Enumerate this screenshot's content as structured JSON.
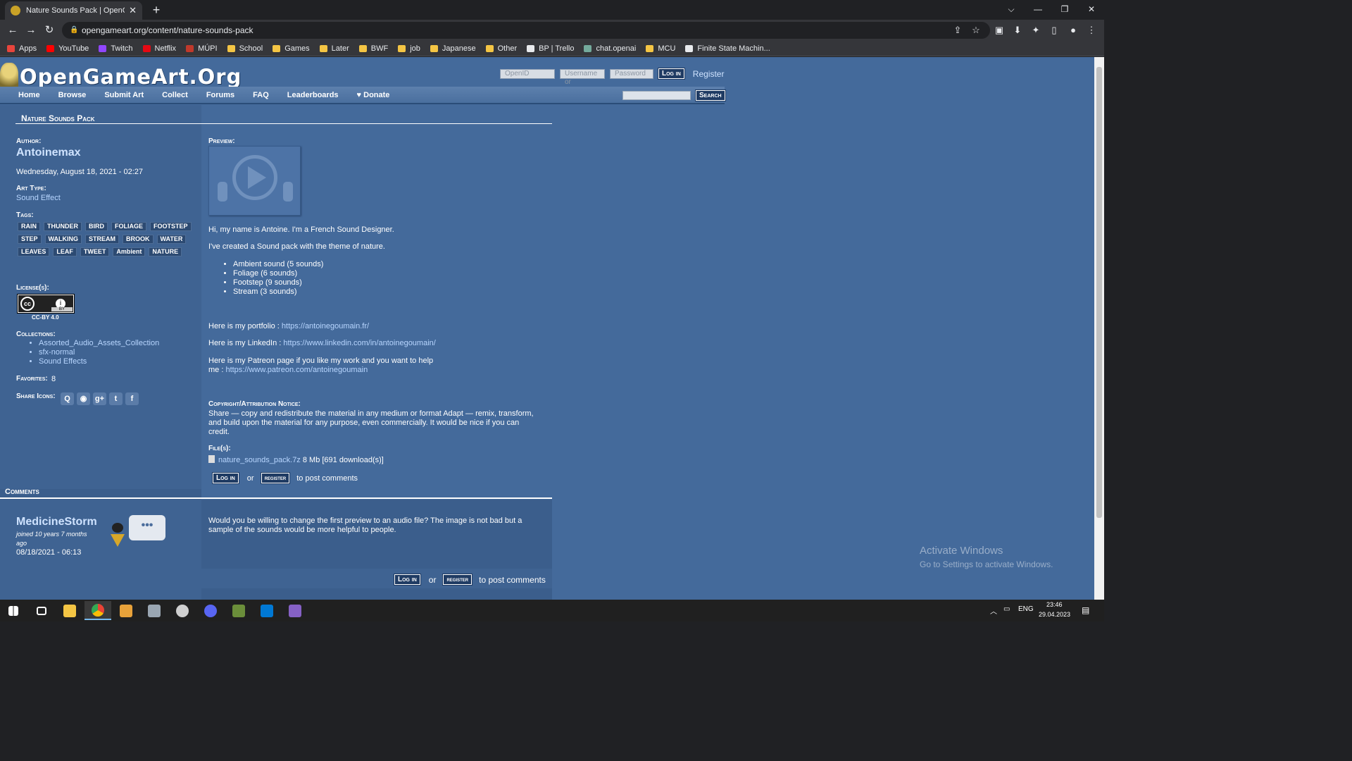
{
  "browser": {
    "tab_title": "Nature Sounds Pack | OpenGame",
    "tab_close": "✕",
    "new_tab": "+",
    "url": "opengameart.org/content/nature-sounds-pack",
    "bookmarks": [
      {
        "label": "Apps",
        "icon": "apps-grid-icon",
        "color": "#e8453c"
      },
      {
        "label": "YouTube",
        "icon": "youtube-icon",
        "color": "#ff0000"
      },
      {
        "label": "Twitch",
        "icon": "twitch-icon",
        "color": "#9146ff"
      },
      {
        "label": "Netflix",
        "icon": "netflix-icon",
        "color": "#e50914"
      },
      {
        "label": "MÚPI",
        "icon": "mupi-icon",
        "color": "#c0392b"
      },
      {
        "label": "School",
        "icon": "folder-icon",
        "color": "#f4c544"
      },
      {
        "label": "Games",
        "icon": "folder-icon",
        "color": "#f4c544"
      },
      {
        "label": "Later",
        "icon": "folder-icon",
        "color": "#f4c544"
      },
      {
        "label": "BWF",
        "icon": "folder-icon",
        "color": "#f4c544"
      },
      {
        "label": "job",
        "icon": "folder-icon",
        "color": "#f4c544"
      },
      {
        "label": "Japanese",
        "icon": "folder-icon",
        "color": "#f4c544"
      },
      {
        "label": "Other",
        "icon": "folder-icon",
        "color": "#f4c544"
      },
      {
        "label": "BP | Trello",
        "icon": "trello-icon",
        "color": "#e8eaed"
      },
      {
        "label": "chat.openai",
        "icon": "openai-icon",
        "color": "#74aa9c"
      },
      {
        "label": "MCU",
        "icon": "folder-icon",
        "color": "#f4c544"
      },
      {
        "label": "Finite State Machin...",
        "icon": "e-icon",
        "color": "#e8eaed"
      }
    ]
  },
  "site": {
    "logo": "OpenGameArt.Org",
    "login": {
      "openid": "OpenID",
      "username": "Username or",
      "password": "Password",
      "button": "Log in",
      "register": "Register"
    },
    "nav": [
      "Home",
      "Browse",
      "Submit Art",
      "Collect",
      "Forums",
      "FAQ",
      "Leaderboards",
      "♥ Donate"
    ],
    "search_button": "Search"
  },
  "content": {
    "title": "Nature Sounds Pack",
    "author_label": "Author:",
    "author": "Antoinemax",
    "date": "Wednesday, August 18, 2021 - 02:27",
    "art_type_label": "Art Type:",
    "art_type": "Sound Effect",
    "tags_label": "Tags:",
    "tags": [
      "RAIN",
      "THUNDER",
      "BIRD",
      "FOLIAGE",
      "FOOTSTEP",
      "STEP",
      "WALKING",
      "STREAM",
      "BROOK",
      "WATER",
      "LEAVES",
      "LEAF",
      "TWEET",
      "Ambient",
      "NATURE"
    ],
    "license_label": "License(s):",
    "license": "CC-BY 4.0",
    "license_badge_cc": "cc",
    "license_badge_by": "BY",
    "collections_label": "Collections:",
    "collections": [
      "Assorted_Audio_Assets_Collection",
      "sfx-normal",
      "Sound Effects"
    ],
    "favorites_label": "Favorites:",
    "favorites": "8",
    "share_label": "Share Icons:",
    "share_icons": [
      "Q",
      "◉",
      "g+",
      "t",
      "f"
    ],
    "preview_label": "Preview:",
    "intro1": "Hi, my name is Antoine. I'm a French Sound Designer.",
    "intro2": "I've created a Sound pack with the theme of nature.",
    "bullets": [
      "Ambient sound (5 sounds)",
      "Foliage (6 sounds)",
      "Footstep (9 sounds)",
      "Stream (3 sounds)"
    ],
    "portfolio_text": "Here is my portfolio : ",
    "portfolio_url": "https://antoinegoumain.fr/",
    "linkedin_text": "Here is my LinkedIn : ",
    "linkedin_url": "https://www.linkedin.com/in/antoinegoumain/",
    "patreon_text_1": "Here is my Patreon page if you like my work and you want to help",
    "patreon_text_2": "me : ",
    "patreon_url": "https://www.patreon.com/antoinegoumain",
    "notice_label": "Copyright/Attribution Notice:",
    "notice_1": "Share — copy and redistribute the material in any medium or format Adapt — remix, transform,",
    "notice_2": "and build upon the material for any purpose, even commercially. It would be nice if you can",
    "notice_3": "credit.",
    "files_label": "File(s):",
    "file_name": "nature_sounds_pack.7z",
    "file_meta": " 8 Mb [691 download(s)]",
    "login_btn": "Log in",
    "or": "or",
    "register_btn": "register",
    "post_comments": "to post comments"
  },
  "comments": {
    "header": "Comments",
    "items": [
      {
        "user": "MedicineStorm",
        "joined_1": "joined 10 years 7 months",
        "joined_2": "ago",
        "date": "08/18/2021 - 06:13",
        "bubble": "•••",
        "text_1": "Would you be willing to change the first preview to an audio file? The image is not bad but a",
        "text_2": "sample of the sounds would be more helpful to people."
      }
    ]
  },
  "watermark": {
    "line1": "Activate Windows",
    "line2": "Go to Settings to activate Windows."
  },
  "taskbar": {
    "lang": "ENG",
    "time": "23:46",
    "date": "29.04.2023"
  }
}
